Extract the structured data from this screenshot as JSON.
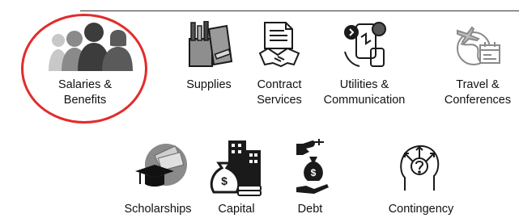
{
  "categories_top": [
    {
      "id": "salaries",
      "line1": "Salaries &",
      "line2": "Benefits",
      "icon": "people-silhouettes-icon",
      "highlighted": true
    },
    {
      "id": "supplies",
      "line1": "Supplies",
      "line2": "",
      "icon": "office-supplies-icon"
    },
    {
      "id": "contract",
      "line1": "Contract",
      "line2": "Services",
      "icon": "contract-handshake-icon"
    },
    {
      "id": "utilities",
      "line1": "Utilities &",
      "line2": "Communication",
      "icon": "phone-utilities-icon"
    },
    {
      "id": "travel",
      "line1": "Travel &",
      "line2": "Conferences",
      "icon": "travel-calendar-icon"
    }
  ],
  "categories_bottom": [
    {
      "id": "scholarships",
      "line1": "Scholarships",
      "icon": "graduation-cap-money-icon"
    },
    {
      "id": "capital",
      "line1": "Capital",
      "icon": "money-bag-buildings-icon"
    },
    {
      "id": "debt",
      "line1": "Debt",
      "icon": "hand-money-bag-icon"
    },
    {
      "id": "contingency",
      "line1": "Contingency",
      "icon": "head-question-icon"
    }
  ],
  "colors": {
    "highlight": "#e32b2b",
    "rule": "#333333",
    "icon": "#1a1a1a"
  }
}
